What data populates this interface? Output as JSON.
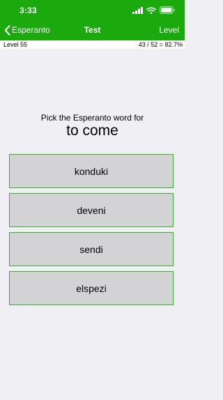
{
  "status_bar": {
    "time": "3:33",
    "icons": [
      "cellular-signal-icon",
      "wifi-icon",
      "battery-icon"
    ]
  },
  "nav": {
    "back_label": "Esperanto",
    "title": "Test",
    "right_label": "Level"
  },
  "info": {
    "level": "Level 55",
    "score": "43 / 52 = 82.7%"
  },
  "question": {
    "prompt": "Pick the Esperanto word for",
    "word": "to come"
  },
  "answers": [
    {
      "label": "konduki"
    },
    {
      "label": "deveni"
    },
    {
      "label": "sendi"
    },
    {
      "label": "elspezi"
    }
  ],
  "colors": {
    "header_green": "#1aaa0e",
    "answer_border": "#35b22a",
    "answer_fill": "#d3d3d6",
    "background": "#efeff4"
  }
}
